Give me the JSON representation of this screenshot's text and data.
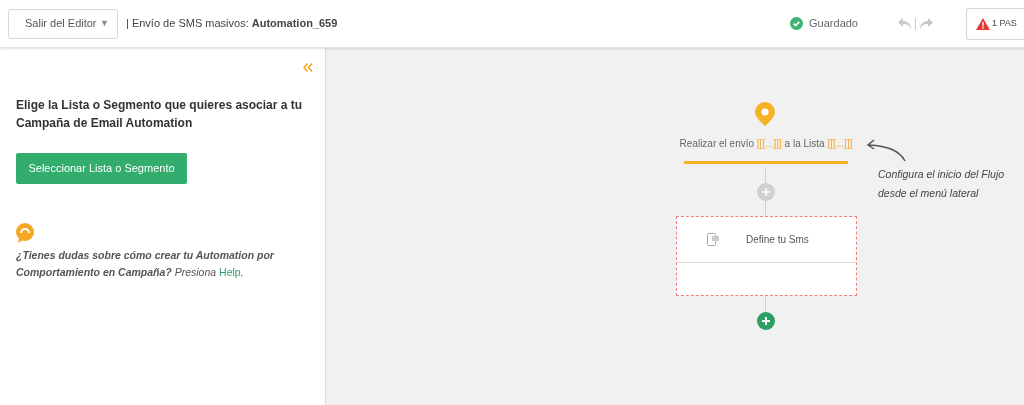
{
  "header": {
    "exit_button": {
      "label": "Salir del Editor",
      "caret": "▼"
    },
    "title": "| Envío de SMS masivos: **Automation_659**",
    "save_status": "Guardado",
    "warning_button": {
      "label": "1 PAS"
    }
  },
  "sidebar": {
    "heading": "Elige la Lista o Segmento que quieres asociar a tu Campaña de Email Automation",
    "button": "Seleccionar Lista o Segmento",
    "help_text": "**¿Tienes dudas sobre cómo crear tu Automation por Comportamiento en Campaña?** Presiona ",
    "help_link": "Help",
    "help_end": "."
  },
  "canvas": {
    "start_node": {
      "parts": [
        {
          "kind": "text",
          "text": "Realizar el envío "
        },
        {
          "kind": "placeholder",
          "text": "[[[...]]]"
        },
        {
          "kind": "text",
          "text": " a la Lista "
        },
        {
          "kind": "placeholder",
          "text": "[[[...]]]"
        }
      ]
    },
    "hint": [
      "Configura el inicio del Flujo",
      "desde el menú lateral"
    ],
    "sms_node": {
      "label": "Define tu Sms"
    }
  }
}
